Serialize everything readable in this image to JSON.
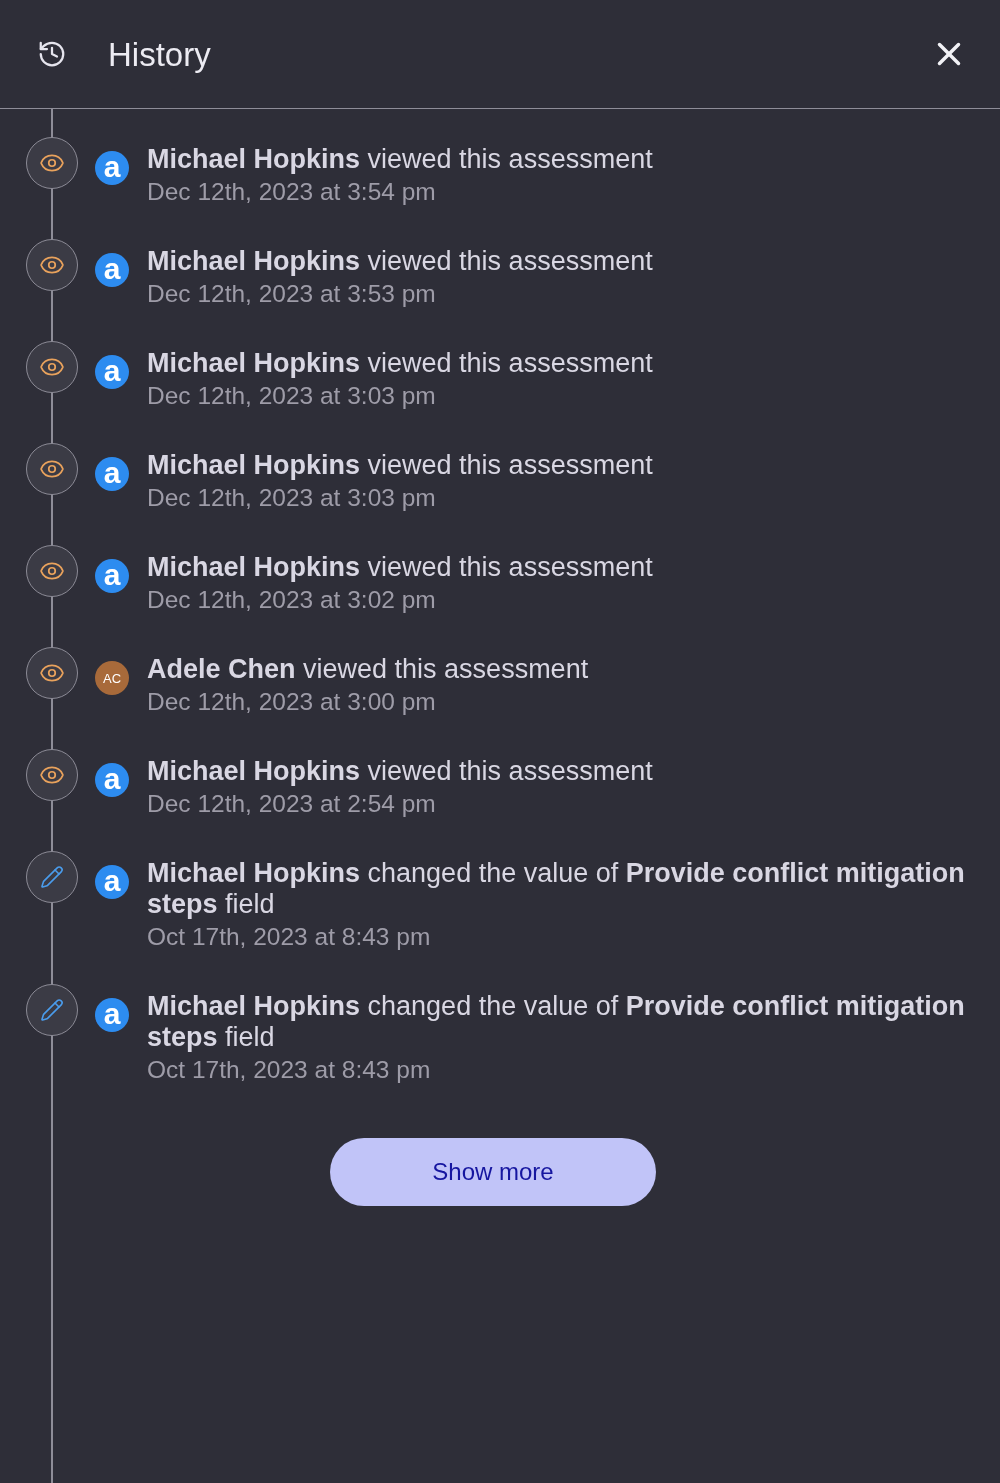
{
  "header": {
    "title": "History"
  },
  "items": [
    {
      "kind": "view",
      "avatar": {
        "kind": "logo",
        "text": "a",
        "color": "#2d8cf0"
      },
      "message": "**Michael Hopkins** viewed this assessment",
      "timestamp": "Dec 12th, 2023 at 3:54 pm"
    },
    {
      "kind": "view",
      "avatar": {
        "kind": "logo",
        "text": "a",
        "color": "#2d8cf0"
      },
      "message": "**Michael Hopkins** viewed this assessment",
      "timestamp": "Dec 12th, 2023 at 3:53 pm"
    },
    {
      "kind": "view",
      "avatar": {
        "kind": "logo",
        "text": "a",
        "color": "#2d8cf0"
      },
      "message": "**Michael Hopkins** viewed this assessment",
      "timestamp": "Dec 12th, 2023 at 3:03 pm"
    },
    {
      "kind": "view",
      "avatar": {
        "kind": "logo",
        "text": "a",
        "color": "#2d8cf0"
      },
      "message": "**Michael Hopkins** viewed this assessment",
      "timestamp": "Dec 12th, 2023 at 3:03 pm"
    },
    {
      "kind": "view",
      "avatar": {
        "kind": "logo",
        "text": "a",
        "color": "#2d8cf0"
      },
      "message": "**Michael Hopkins** viewed this assessment",
      "timestamp": "Dec 12th, 2023 at 3:02 pm"
    },
    {
      "kind": "view",
      "avatar": {
        "kind": "initials",
        "text": "AC",
        "color": "#a86a3a"
      },
      "message": "**Adele Chen** viewed this assessment",
      "timestamp": "Dec 12th, 2023 at 3:00 pm"
    },
    {
      "kind": "view",
      "avatar": {
        "kind": "logo",
        "text": "a",
        "color": "#2d8cf0"
      },
      "message": "**Michael Hopkins** viewed this assessment",
      "timestamp": "Dec 12th, 2023 at 2:54 pm"
    },
    {
      "kind": "edit",
      "avatar": {
        "kind": "logo",
        "text": "a",
        "color": "#2d8cf0"
      },
      "message": "**Michael Hopkins** changed the value of **Provide conflict mitigation steps** field",
      "timestamp": "Oct 17th, 2023 at 8:43 pm"
    },
    {
      "kind": "edit",
      "avatar": {
        "kind": "logo",
        "text": "a",
        "color": "#2d8cf0"
      },
      "message": "**Michael Hopkins** changed the value of **Provide conflict mitigation steps** field",
      "timestamp": "Oct 17th, 2023 at 8:43 pm"
    }
  ],
  "show_more": {
    "label": "Show more"
  }
}
